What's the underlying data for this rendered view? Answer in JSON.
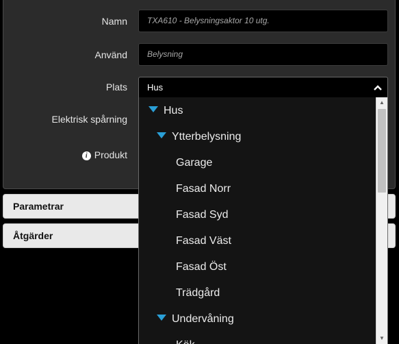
{
  "form": {
    "namn_label": "Namn",
    "namn_value": "TXA610 - Belysningsaktor 10 utg.",
    "anvand_label": "Använd",
    "anvand_value": "Belysning",
    "plats_label": "Plats",
    "plats_value": "Hus",
    "elektrisk_label": "Elektrisk spårning",
    "produkt_label": "Produkt",
    "info_glyph": "i"
  },
  "accordions": {
    "parametrar": "Parametrar",
    "atgarder": "Åtgärder"
  },
  "dropdown": {
    "items": [
      {
        "label": "Hus",
        "level": 0,
        "expanded": true
      },
      {
        "label": "Ytterbelysning",
        "level": 1,
        "expanded": true
      },
      {
        "label": "Garage",
        "level": 2
      },
      {
        "label": "Fasad Norr",
        "level": 2
      },
      {
        "label": "Fasad Syd",
        "level": 2
      },
      {
        "label": "Fasad Väst",
        "level": 2
      },
      {
        "label": "Fasad Öst",
        "level": 2
      },
      {
        "label": "Trädgård",
        "level": 2
      },
      {
        "label": "Undervåning",
        "level": 1,
        "expanded": true
      },
      {
        "label": "Kök",
        "level": 2
      }
    ]
  },
  "icons": {
    "chevron": "chevron-up-icon",
    "expand": "triangle-down-icon",
    "info": "info-icon"
  },
  "colors": {
    "accent": "#2a9fd6",
    "panel_bg": "#2b2b2b",
    "accordion_bg": "#e9e9e9"
  }
}
